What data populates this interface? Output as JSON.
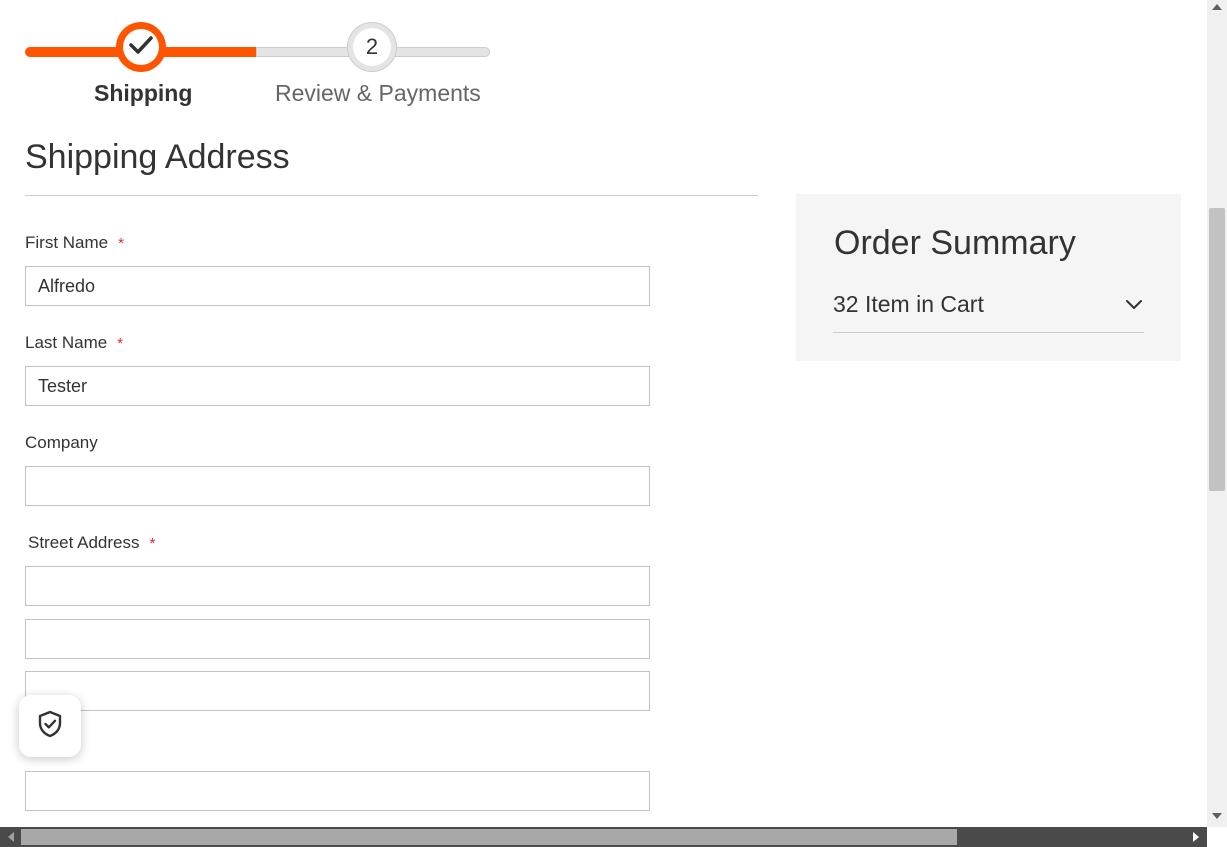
{
  "progress": {
    "steps": [
      {
        "label": "Shipping",
        "state": "complete",
        "icon": "checkmark-icon"
      },
      {
        "number": "2",
        "label": "Review & Payments",
        "state": "upcoming"
      }
    ],
    "accent_color": "#ff5501"
  },
  "shipping": {
    "title": "Shipping Address",
    "required_marker": "*",
    "fields": {
      "first_name": {
        "label": "First Name",
        "value": "Alfredo",
        "required": true
      },
      "last_name": {
        "label": "Last Name",
        "value": "Tester",
        "required": true
      },
      "company": {
        "label": "Company",
        "value": "",
        "required": false
      },
      "street": {
        "label": "Street Address",
        "lines": [
          "",
          "",
          ""
        ],
        "required": true
      },
      "next": {
        "value": ""
      }
    }
  },
  "summary": {
    "title": "Order Summary",
    "items_in_cart": "32 Item in Cart",
    "toggle_icon": "chevron-down-icon"
  },
  "floating": {
    "icon": "shield-check-icon"
  }
}
